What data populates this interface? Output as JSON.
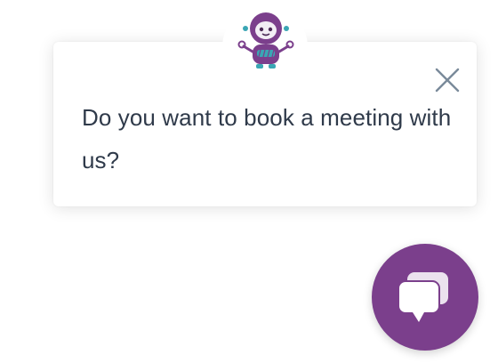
{
  "chat_popup": {
    "message": "Do you want to book a meeting with us?"
  },
  "icons": {
    "avatar": "robot-avatar-icon",
    "close": "close-icon",
    "launcher": "chat-bubbles-icon"
  },
  "colors": {
    "accent": "#7b3f8c",
    "text": "#2f3a4a",
    "close_icon": "#7a8a9a"
  }
}
